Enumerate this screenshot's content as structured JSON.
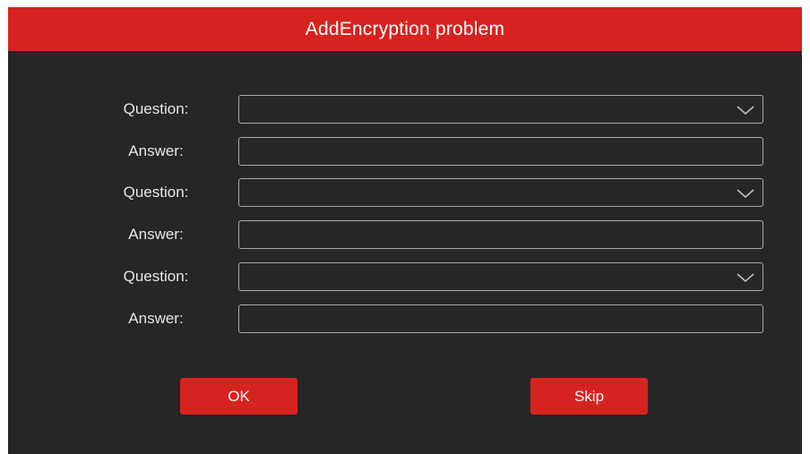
{
  "dialog": {
    "title": "AddEncryption problem",
    "accent_color": "#d7231f",
    "background_color": "#262626"
  },
  "fields": [
    {
      "question_label": "Question:",
      "question_value": "",
      "answer_label": "Answer:",
      "answer_value": "",
      "dropdown_icon": "chevron-down-icon"
    },
    {
      "question_label": "Question:",
      "question_value": "",
      "answer_label": "Answer:",
      "answer_value": "",
      "dropdown_icon": "chevron-down-icon"
    },
    {
      "question_label": "Question:",
      "question_value": "",
      "answer_label": "Answer:",
      "answer_value": "",
      "dropdown_icon": "chevron-down-icon"
    }
  ],
  "buttons": {
    "ok_label": "OK",
    "skip_label": "Skip"
  }
}
